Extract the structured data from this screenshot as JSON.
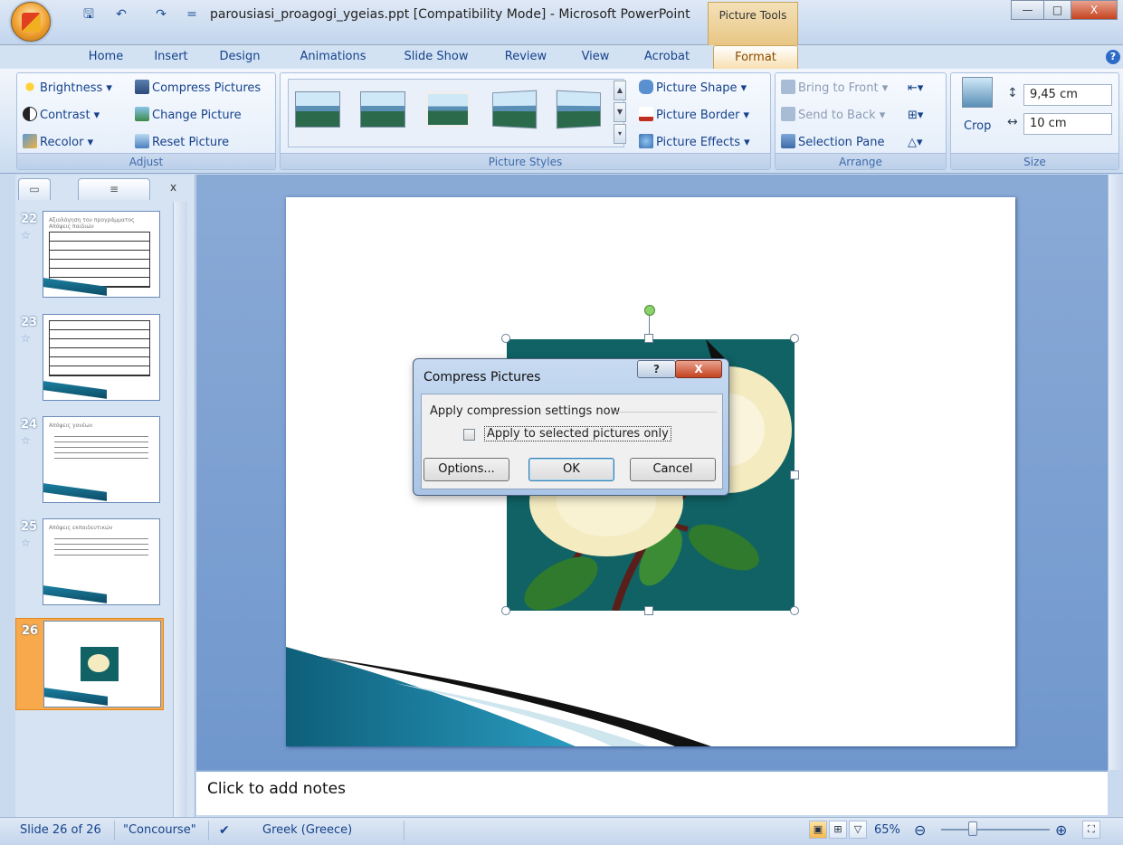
{
  "window": {
    "title": "parousiasi_proagogi_ygeias.ppt [Compatibility Mode] - Microsoft PowerPoint",
    "contextual_tab_group": "Picture Tools",
    "minimize": "—",
    "maximize": "□",
    "close": "X"
  },
  "quick_access": {
    "save": "🖫",
    "undo": "↶",
    "redo": "↷",
    "customize": "="
  },
  "tabs": [
    "Home",
    "Insert",
    "Design",
    "Animations",
    "Slide Show",
    "Review",
    "View",
    "Acrobat",
    "Format"
  ],
  "active_tab": "Format",
  "ribbon": {
    "adjust": {
      "label": "Adjust",
      "brightness": "Brightness ▾",
      "contrast": "Contrast ▾",
      "recolor": "Recolor ▾",
      "compress": "Compress Pictures",
      "change": "Change Picture",
      "reset": "Reset Picture"
    },
    "styles": {
      "label": "Picture Styles",
      "shape": "Picture Shape ▾",
      "border": "Picture Border ▾",
      "effects": "Picture Effects ▾"
    },
    "arrange": {
      "label": "Arrange",
      "front": "Bring to Front ▾",
      "back": "Send to Back ▾",
      "selection": "Selection Pane"
    },
    "size": {
      "label": "Size",
      "crop": "Crop",
      "height": "9,45 cm",
      "width": "10 cm"
    }
  },
  "slides_panel": {
    "tab_slides": "▭",
    "tab_outline": "≡",
    "close": "x",
    "slides": [
      {
        "number": "22",
        "title": "Αξιολόγηση του προγράμματος Απόψεις παιδιών"
      },
      {
        "number": "23",
        "title": ""
      },
      {
        "number": "24",
        "title": "Απόψεις γονέων"
      },
      {
        "number": "25",
        "title": "Απόψεις εκπαιδευτικών"
      },
      {
        "number": "26",
        "title": ""
      }
    ]
  },
  "dialog": {
    "title": "Compress Pictures",
    "help": "?",
    "close": "X",
    "group_label": "Apply compression settings now",
    "checkbox_label": "Apply to selected pictures only",
    "checkbox_checked": false,
    "options": "Options...",
    "ok": "OK",
    "cancel": "Cancel"
  },
  "notes": {
    "placeholder": "Click to add notes"
  },
  "status": {
    "slide": "Slide 26 of 26",
    "theme": "\"Concourse\"",
    "language": "Greek (Greece)",
    "zoom": "65%"
  },
  "colors": {
    "accent": "#f7a94c",
    "picture_bg": "#106265",
    "ribbon": "#dbe7f5"
  }
}
